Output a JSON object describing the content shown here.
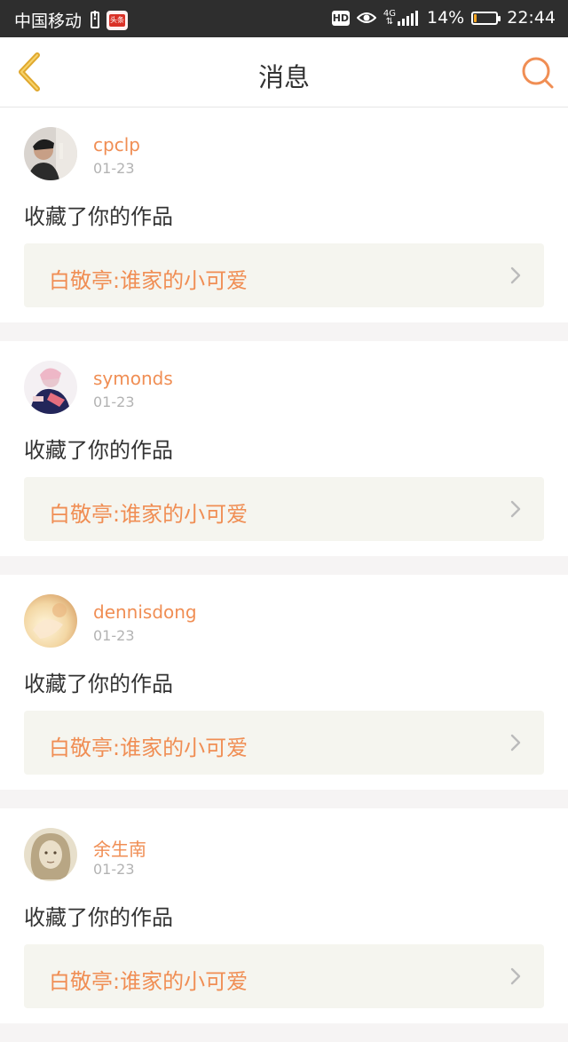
{
  "status_bar": {
    "carrier": "中国移动",
    "app_badge": "头条",
    "hd": "HD",
    "network": "4G",
    "battery_percent": "14%",
    "battery_level": 0.14,
    "time": "22:44"
  },
  "header": {
    "title": "消息",
    "back_icon": "chevron-left-icon",
    "search_icon": "search-icon",
    "accent": "#f08e54",
    "back_color": "#e0a82e"
  },
  "messages": [
    {
      "username": "cpclp",
      "date": "01-23",
      "action": "收藏了你的作品",
      "work_title": "白敬亭:谁家的小可爱"
    },
    {
      "username": "symonds",
      "date": "01-23",
      "action": "收藏了你的作品",
      "work_title": "白敬亭:谁家的小可爱"
    },
    {
      "username": "dennisdong",
      "date": "01-23",
      "action": "收藏了你的作品",
      "work_title": "白敬亭:谁家的小可爱"
    },
    {
      "username": "余生南",
      "date": "01-23",
      "action": "收藏了你的作品",
      "work_title": "白敬亭:谁家的小可爱"
    }
  ]
}
